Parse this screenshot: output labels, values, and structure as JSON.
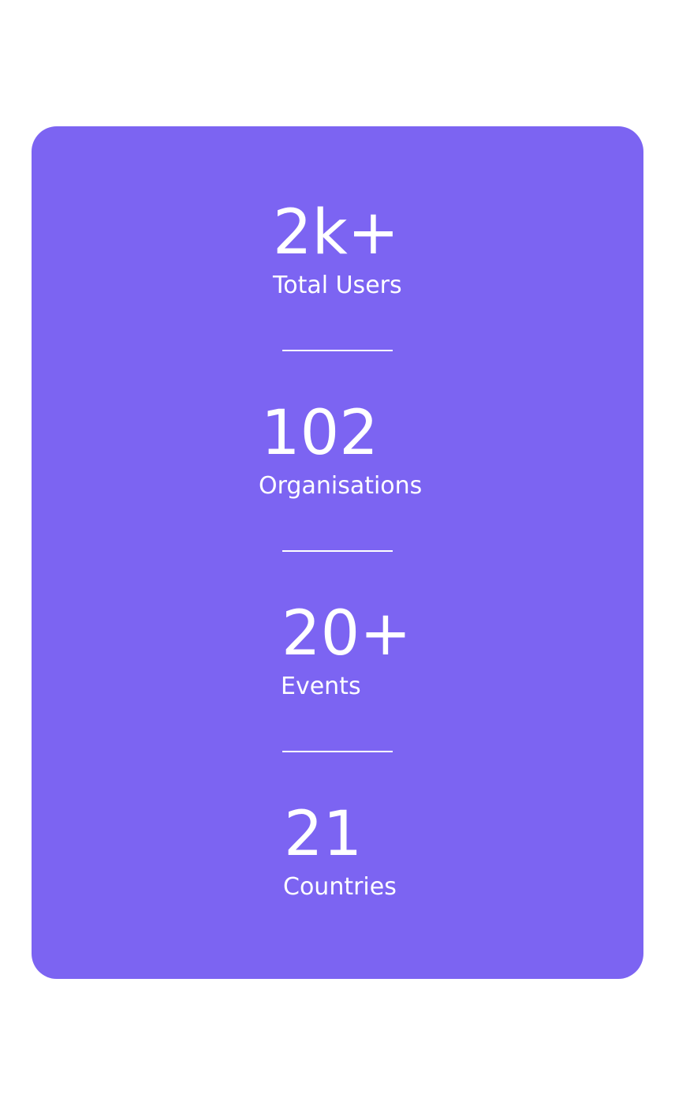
{
  "card": {
    "background_color": "#7c64f2",
    "text_color": "#ffffff"
  },
  "stats": [
    {
      "value": "2k+",
      "label": "Total Users"
    },
    {
      "value": "102",
      "label": "Organisations"
    },
    {
      "value": "20+",
      "label": "Events"
    },
    {
      "value": "21",
      "label": "Countries"
    }
  ]
}
